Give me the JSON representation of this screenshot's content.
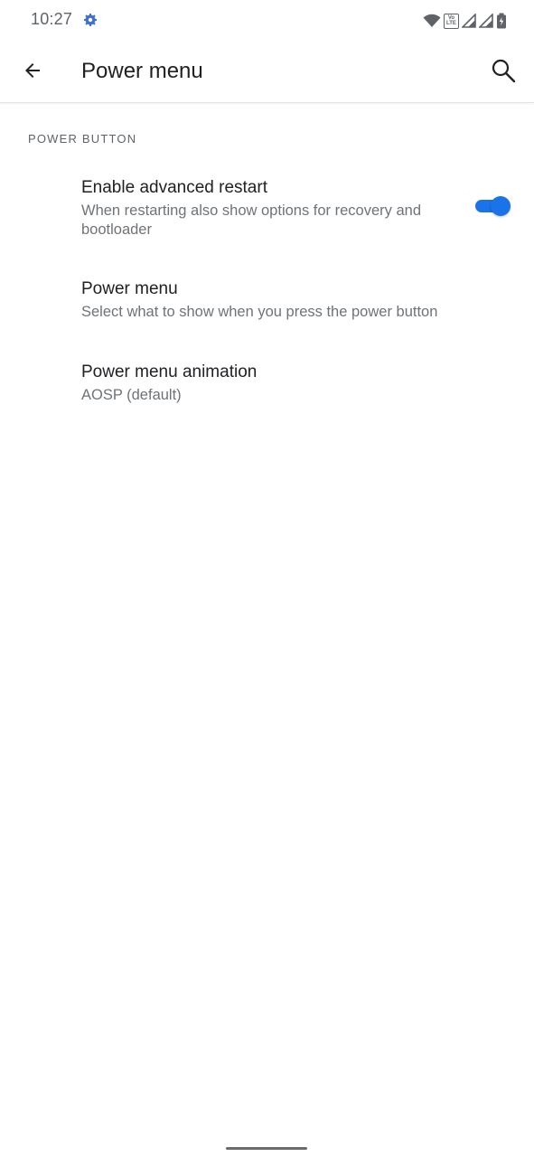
{
  "status_bar": {
    "time": "10:27",
    "app_icon": "settings-gear-icon",
    "volte_top": "Vo",
    "volte_bottom": "LTE",
    "icons": [
      "wifi-icon",
      "volte-icon",
      "signal-icon",
      "signal-icon",
      "battery-icon"
    ]
  },
  "app_bar": {
    "title": "Power menu",
    "back_icon": "arrow-back-icon",
    "search_icon": "search-icon"
  },
  "section": {
    "header": "POWER BUTTON"
  },
  "items": [
    {
      "title": "Enable advanced restart",
      "summary": "When restarting also show options for recovery and bootloader",
      "toggle_on": true
    },
    {
      "title": "Power menu",
      "summary": "Select what to show when you press the power button"
    },
    {
      "title": "Power menu animation",
      "summary": "AOSP (default)"
    }
  ],
  "colors": {
    "accent": "#1a73e8",
    "text_primary": "#202124",
    "text_secondary": "#6f7377"
  }
}
